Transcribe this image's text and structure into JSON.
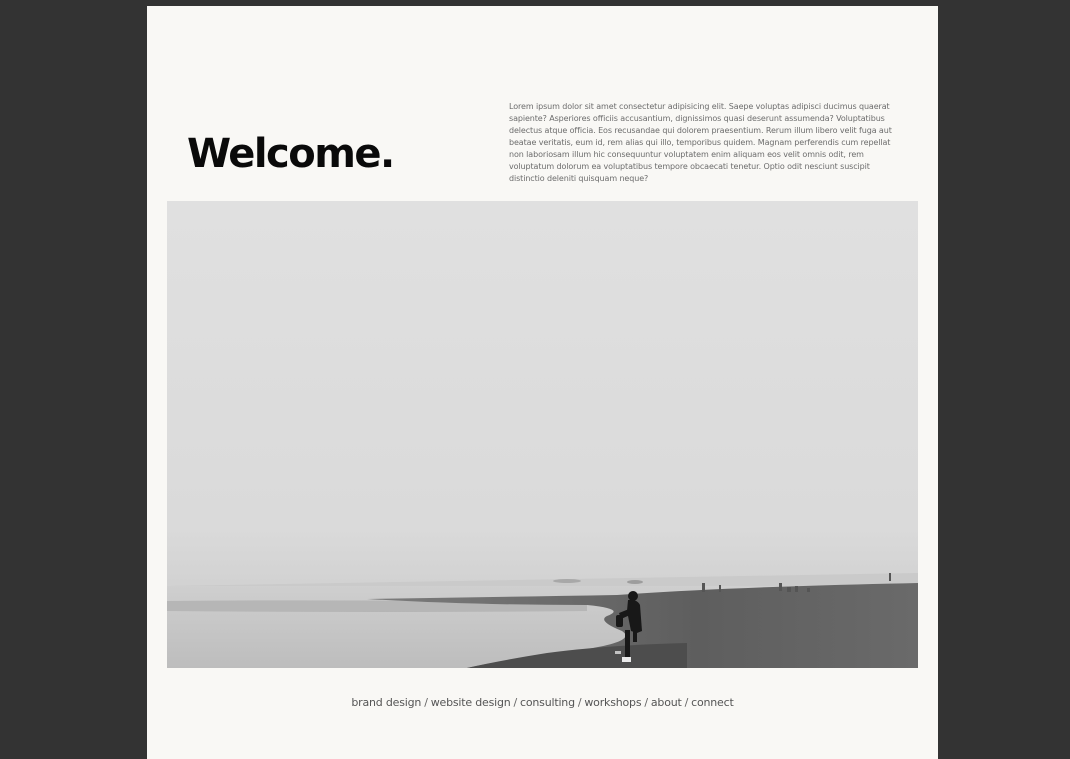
{
  "hero": {
    "heading": "Welcome.",
    "intro": "Lorem ipsum dolor sit amet consectetur adipisicing elit. Saepe voluptas adipisci ducimus quaerat sapiente? Asperiores officiis accusantium, dignissimos quasi deserunt assumenda? Voluptatibus delectus atque officia. Eos recusandae qui dolorem praesentium. Rerum illum libero velit fuga aut beatae veritatis, eum id, rem alias qui illo, temporibus quidem. Magnam perferendis cum repellat non laboriosam illum hic consequuntur voluptatem enim aliquam eos velit omnis odit, rem voluptatum dolorum ea voluptatibus tempore obcaecati tenetur. Optio odit nesciunt suscipit distinctio deleniti quisquam neque?"
  },
  "nav": {
    "items": [
      "brand design",
      "website design",
      "consulting",
      "workshops",
      "about",
      "connect"
    ],
    "separator": "/"
  },
  "colors": {
    "outer_background": "#333333",
    "page_background": "#f9f8f5",
    "heading": "#0a0a0a",
    "body_text": "#6c6c6c"
  }
}
